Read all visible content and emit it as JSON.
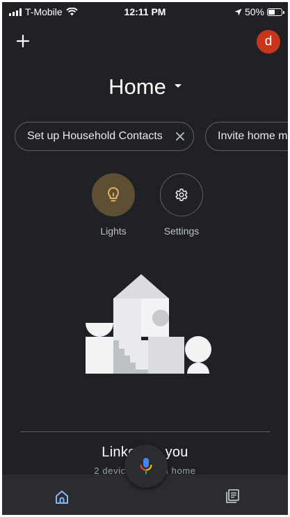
{
  "status_bar": {
    "carrier": "T-Mobile",
    "time": "12:11 PM",
    "battery": "50%",
    "battery_level": 0.5
  },
  "header": {
    "title": "Home",
    "avatar_initial": "d"
  },
  "chips": {
    "contacts_label": "Set up Household Contacts",
    "invite_label": "Invite home me"
  },
  "actions": {
    "lights_label": "Lights",
    "settings_label": "Settings"
  },
  "linked": {
    "title_left": "Linke",
    "title_right": "you",
    "subtitle_left": "2 device",
    "subtitle_right": "a home"
  },
  "colors": {
    "background": "#202124",
    "avatar": "#c5361b",
    "lights_circle": "#5e4f34",
    "lights_icon": "#f2c064",
    "nav_active": "#8ab4f8"
  },
  "icons": {
    "add": "plus-icon",
    "lights": "lightbulb-icon",
    "settings": "gear-icon",
    "close": "close-icon",
    "nav_home": "home-icon",
    "nav_feed": "feed-icon",
    "mic": "microphone-icon"
  }
}
